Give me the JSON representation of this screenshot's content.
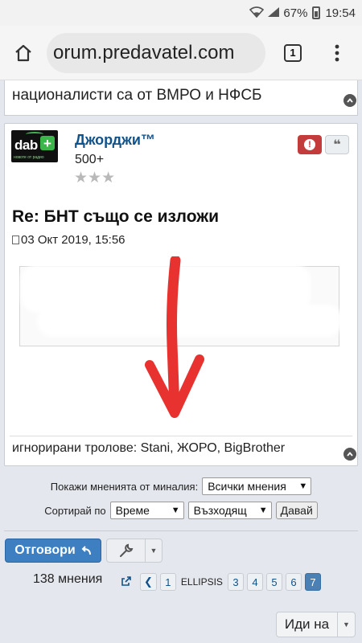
{
  "status_bar": {
    "battery": "67%",
    "time": "19:54"
  },
  "browser": {
    "url": "orum.predavatel.com",
    "tab_count": "1"
  },
  "prev_post": {
    "text": "националисти са от ВМРО и НФСБ"
  },
  "post": {
    "avatar_text": "dab",
    "avatar_sub": "новоте от радио",
    "username": "Джорджи™",
    "rank": "500+",
    "stars": "★★★",
    "title": "Re: БНТ също се изложи",
    "date": "03 Окт 2019, 15:56",
    "signature": "игнорирани тролове: Stani, ЖОРО, BigBrother"
  },
  "controls": {
    "show_label": "Покажи мненията от миналия:",
    "show_value": "Всички мнения",
    "sort_label": "Сортирай по",
    "sort_value": "Време",
    "order_value": "Възходящ",
    "go_label": "Давай"
  },
  "actions": {
    "reply_label": "Отговори"
  },
  "pagination": {
    "count": "138 мнения",
    "pages": [
      "1",
      "ELLIPSIS",
      "3",
      "4",
      "5",
      "6",
      "7"
    ],
    "active": "7"
  },
  "jump": {
    "label": "Иди на"
  },
  "colors": {
    "link_blue": "#105289",
    "reply_blue": "#3d7fc1",
    "report_red": "#c43b3b",
    "arrow_red": "#e8322f"
  }
}
